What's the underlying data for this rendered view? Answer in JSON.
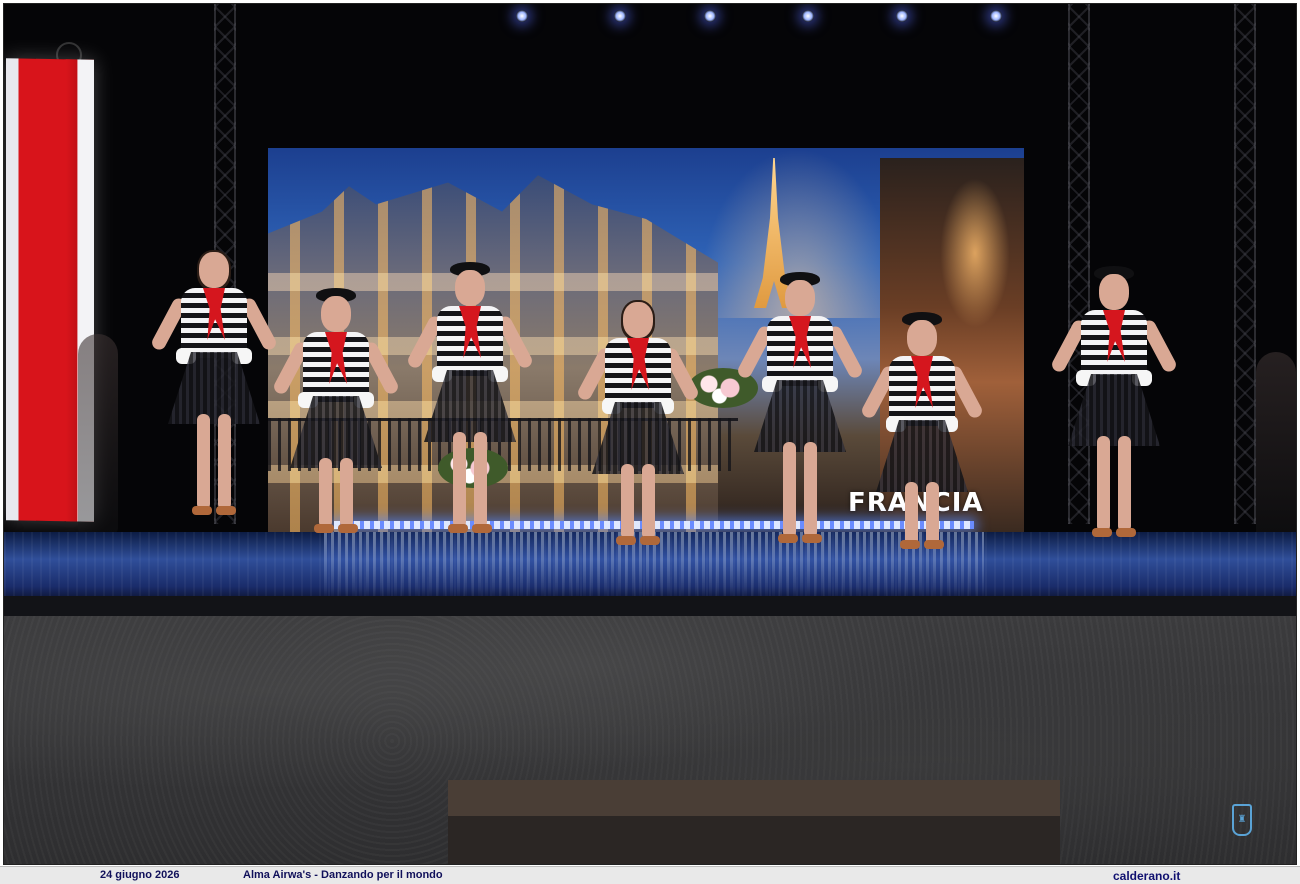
{
  "photo": {
    "scene": "stage performance",
    "screen_caption": "FRANCIA",
    "dancer_count": 7
  },
  "footer": {
    "date": "24 giugno 2026",
    "event": "Alma Airwa's - Danzando per il mondo",
    "site": "calderano.it"
  },
  "colors": {
    "flag_red": "#d8141b",
    "scarf_red": "#d5161e",
    "stage_blue": "#304f9a",
    "footer_text": "#10105a"
  },
  "icons": [
    "stage-light-icon",
    "emblem-icon",
    "crest-icon"
  ]
}
